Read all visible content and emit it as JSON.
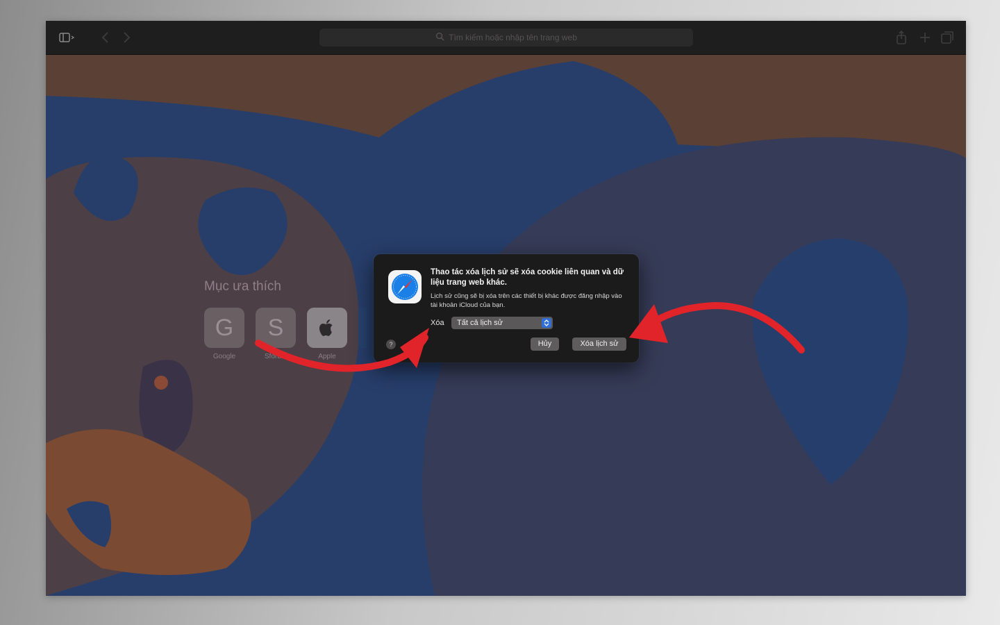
{
  "toolbar": {
    "search_placeholder": "Tìm kiếm hoặc nhập tên trang web",
    "icons": [
      "sidebar-icon",
      "back-icon",
      "forward-icon",
      "search-icon",
      "share-icon",
      "new-tab-icon",
      "tab-overview-icon"
    ]
  },
  "favorites": {
    "title": "Mục ưa thích",
    "items": [
      {
        "letter": "G",
        "label": "Google"
      },
      {
        "letter": "S",
        "label": "Sforum"
      },
      {
        "letter": "",
        "label": "Apple"
      }
    ]
  },
  "dialog": {
    "title": "Thao tác xóa lịch sử sẽ xóa cookie liên quan và dữ liệu trang web khác.",
    "description": "Lịch sử cũng sẽ bị xóa trên các thiết bị khác được đăng nhập vào tài khoản iCloud của bạn.",
    "clear_label": "Xóa",
    "range_selected": "Tất cả lịch sử",
    "help_label": "?",
    "cancel_label": "Hủy",
    "confirm_label": "Xóa lịch sử"
  },
  "colors": {
    "annotation_arrow": "#e0242a",
    "select_accent": "#2f6fd6"
  }
}
